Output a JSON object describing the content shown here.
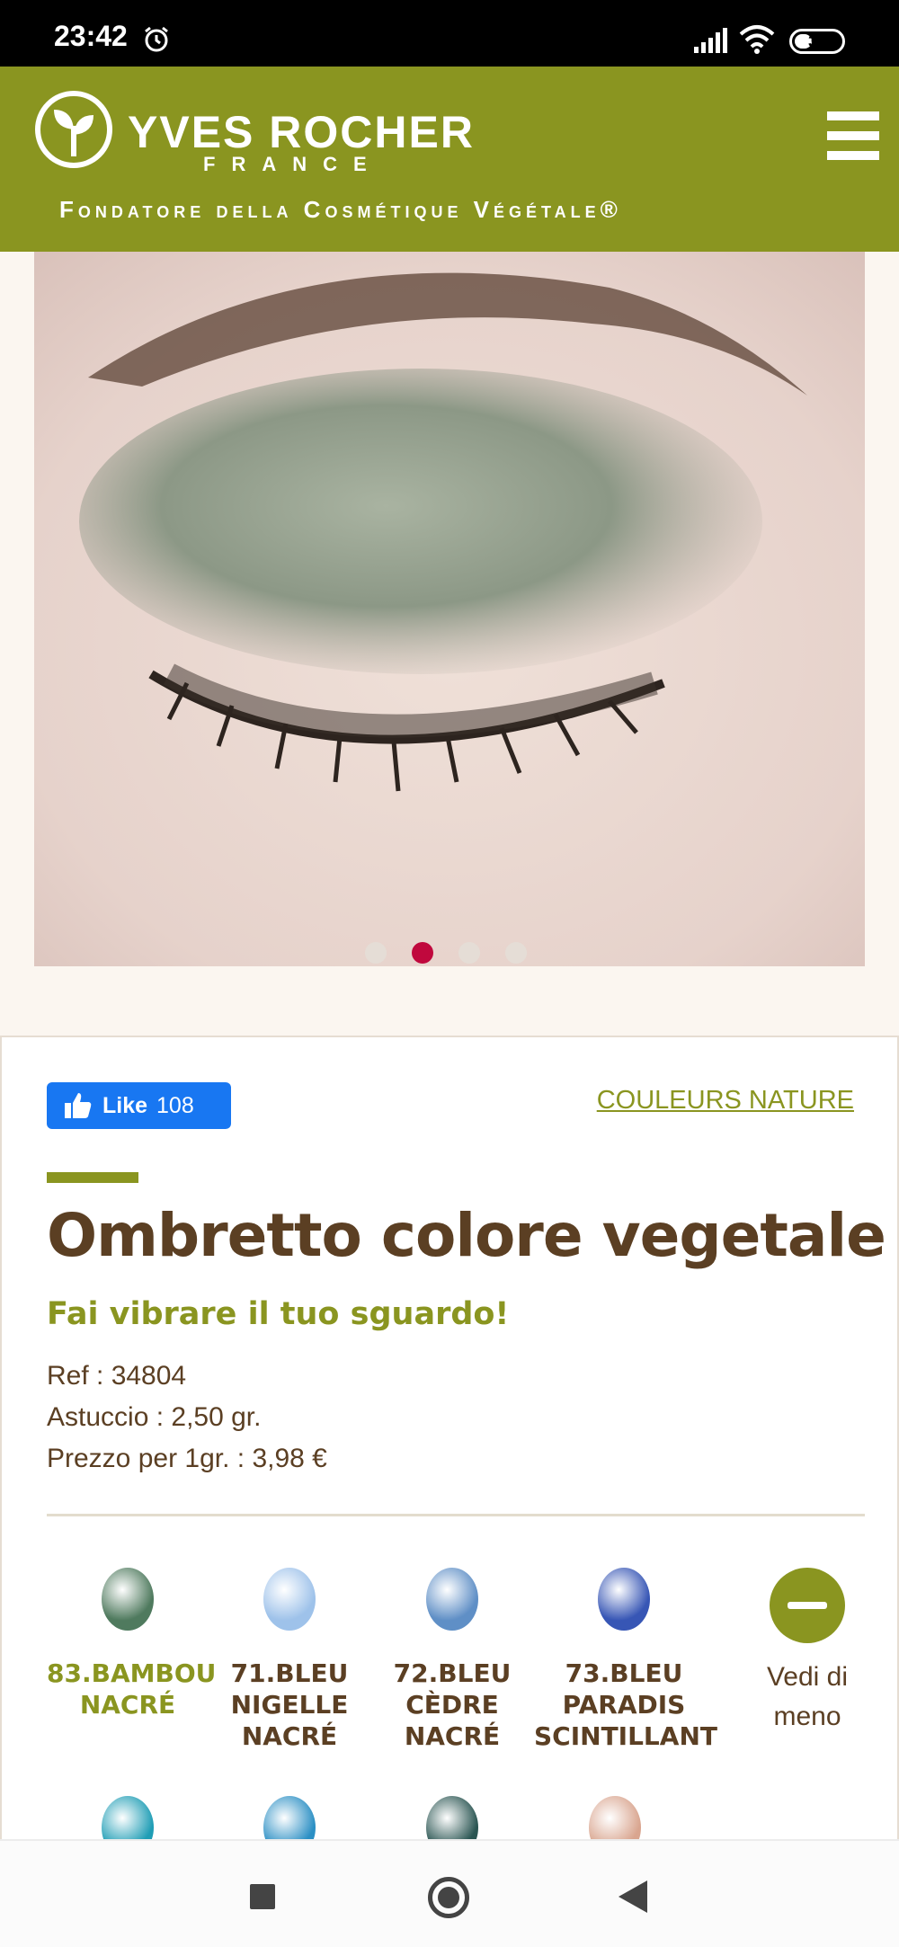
{
  "status_bar": {
    "time": "23:42",
    "battery": "37",
    "battery_level": 0.37,
    "icons": [
      "alarm-icon",
      "signal-icon",
      "wifi-icon",
      "battery-icon"
    ]
  },
  "header": {
    "brand": "YVES ROCHER",
    "country": "FRANCE",
    "tagline": "Fondatore della Cosmétique Végétale®",
    "menu_icon": "hamburger-menu-icon"
  },
  "carousel": {
    "slide_count": 4,
    "active_index": 1
  },
  "product": {
    "like_label": "Like",
    "like_count": "108",
    "collection_link": "COULEURS NATURE",
    "title": "Ombretto colore vegetale",
    "subtitle": "Fai vibrare il tuo sguardo!",
    "specs": [
      "Ref : 34804",
      "Astuccio : 2,50 gr.",
      "Prezzo per 1gr. : 3,98 €"
    ]
  },
  "shades": [
    {
      "label_1": "83.BAMBOU",
      "label_2": "NACRÉ",
      "label_3": "",
      "color": "#4f7a5e",
      "selected": true
    },
    {
      "label_1": "71.BLEU",
      "label_2": "NIGELLE",
      "label_3": "NACRÉ",
      "color": "#9ec2ea",
      "selected": false
    },
    {
      "label_1": "72.BLEU",
      "label_2": "CÈDRE",
      "label_3": "NACRÉ",
      "color": "#5f8fc6",
      "selected": false
    },
    {
      "label_1": "73.BLEU",
      "label_2": "PARADIS",
      "label_3": "SCINTILLANT",
      "color": "#3756b5",
      "selected": false
    }
  ],
  "less_toggle": {
    "label_1": "Vedi di",
    "label_2": "meno"
  },
  "next_row_colors": [
    "#1f9db5",
    "#2b8fc4",
    "#2a5552",
    "#d9a58f"
  ],
  "colors": {
    "brand_green": "#8a9520",
    "text_brown": "#5b3f23",
    "accent_red": "#c0083d",
    "facebook_blue": "#1877f2"
  }
}
